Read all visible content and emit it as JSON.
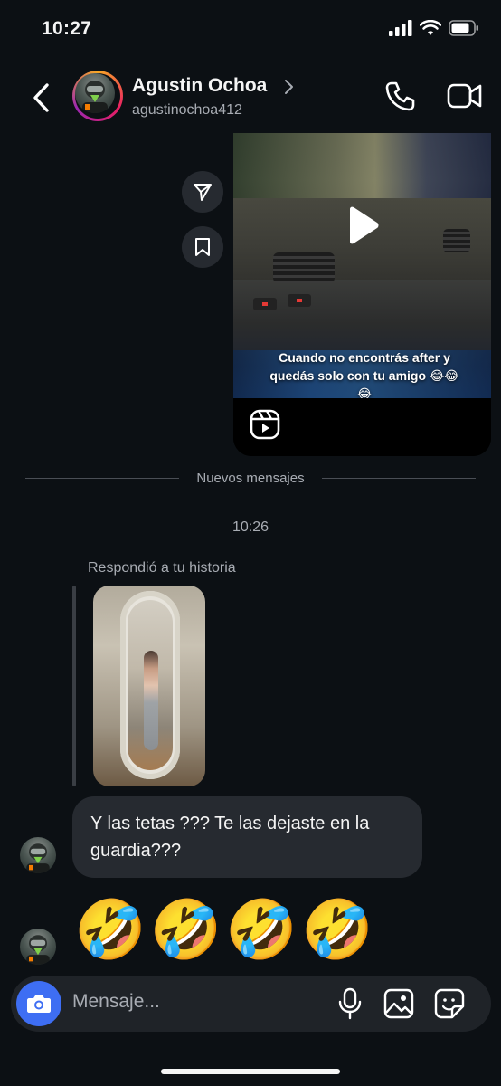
{
  "status_bar": {
    "time": "10:27"
  },
  "header": {
    "name": "Agustin Ochoa",
    "username": "agustinochoa412"
  },
  "reel": {
    "caption": "Cuando no encontrás after y quedás solo con tu amigo 😂😂😂"
  },
  "divider": {
    "label": "Nuevos mensajes"
  },
  "timestamp": "10:26",
  "story_reply": {
    "label": "Respondió a tu historia"
  },
  "messages": [
    {
      "text": "Y las tetas ??? Te las dejaste en la guardia???"
    },
    {
      "text": "🤣🤣🤣🤣"
    }
  ],
  "composer": {
    "placeholder": "Mensaje..."
  },
  "colors": {
    "background": "#0c1014",
    "bubble": "#262a30",
    "accent": "#3e6ef3",
    "muted": "#a8acb3"
  }
}
